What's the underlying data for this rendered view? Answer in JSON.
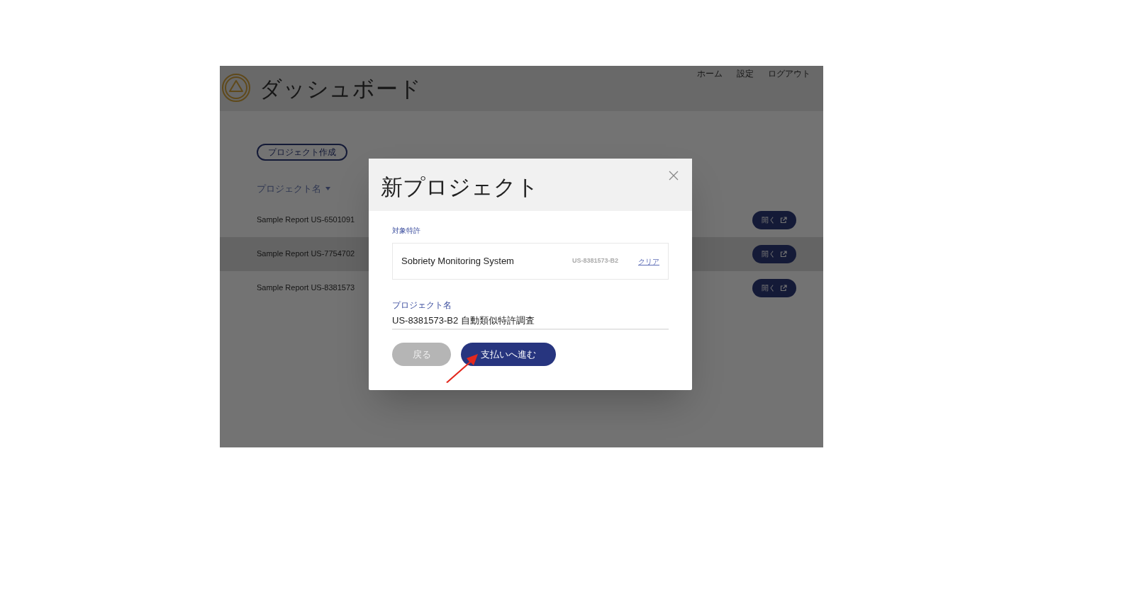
{
  "header": {
    "title": "ダッシュボード",
    "nav": [
      "ホーム",
      "設定",
      "ログアウト"
    ]
  },
  "create_button": "プロジェクト作成",
  "table": {
    "column": "プロジェクト名",
    "rows": [
      {
        "name": "Sample Report US-6501091",
        "button": "開く",
        "selected": false
      },
      {
        "name": "Sample Report US-7754702",
        "button": "開く",
        "selected": true
      },
      {
        "name": "Sample Report US-8381573",
        "button": "開く",
        "selected": false
      }
    ]
  },
  "dialog": {
    "title": "新プロジェクト",
    "patent_label": "対象特許",
    "patent_title": "Sobriety Monitoring System",
    "patent_number": "US-8381573-B2",
    "clear_link": "クリア",
    "name_label": "プロジェクト名",
    "name_value": "US-8381573-B2 自動類似特許調査",
    "buttons": [
      {
        "label": "戻る",
        "kind": "back",
        "disabled": true
      },
      {
        "label": "支払いへ進む",
        "kind": "primary",
        "disabled": false
      }
    ]
  }
}
